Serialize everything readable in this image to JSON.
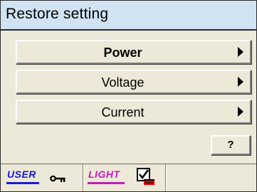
{
  "window": {
    "title": "Restore setting"
  },
  "menu": {
    "items": [
      {
        "label": "Power",
        "bold": true
      },
      {
        "label": "Voltage",
        "bold": false
      },
      {
        "label": "Current",
        "bold": false
      }
    ]
  },
  "help": {
    "label": "?"
  },
  "status": {
    "user_label": "USER",
    "light_label": "LIGHT",
    "user_color": "#1a1ad6",
    "light_color": "#c21fb5",
    "user_icon": "key-icon",
    "light_icon": "checkbox-checked-icon"
  }
}
